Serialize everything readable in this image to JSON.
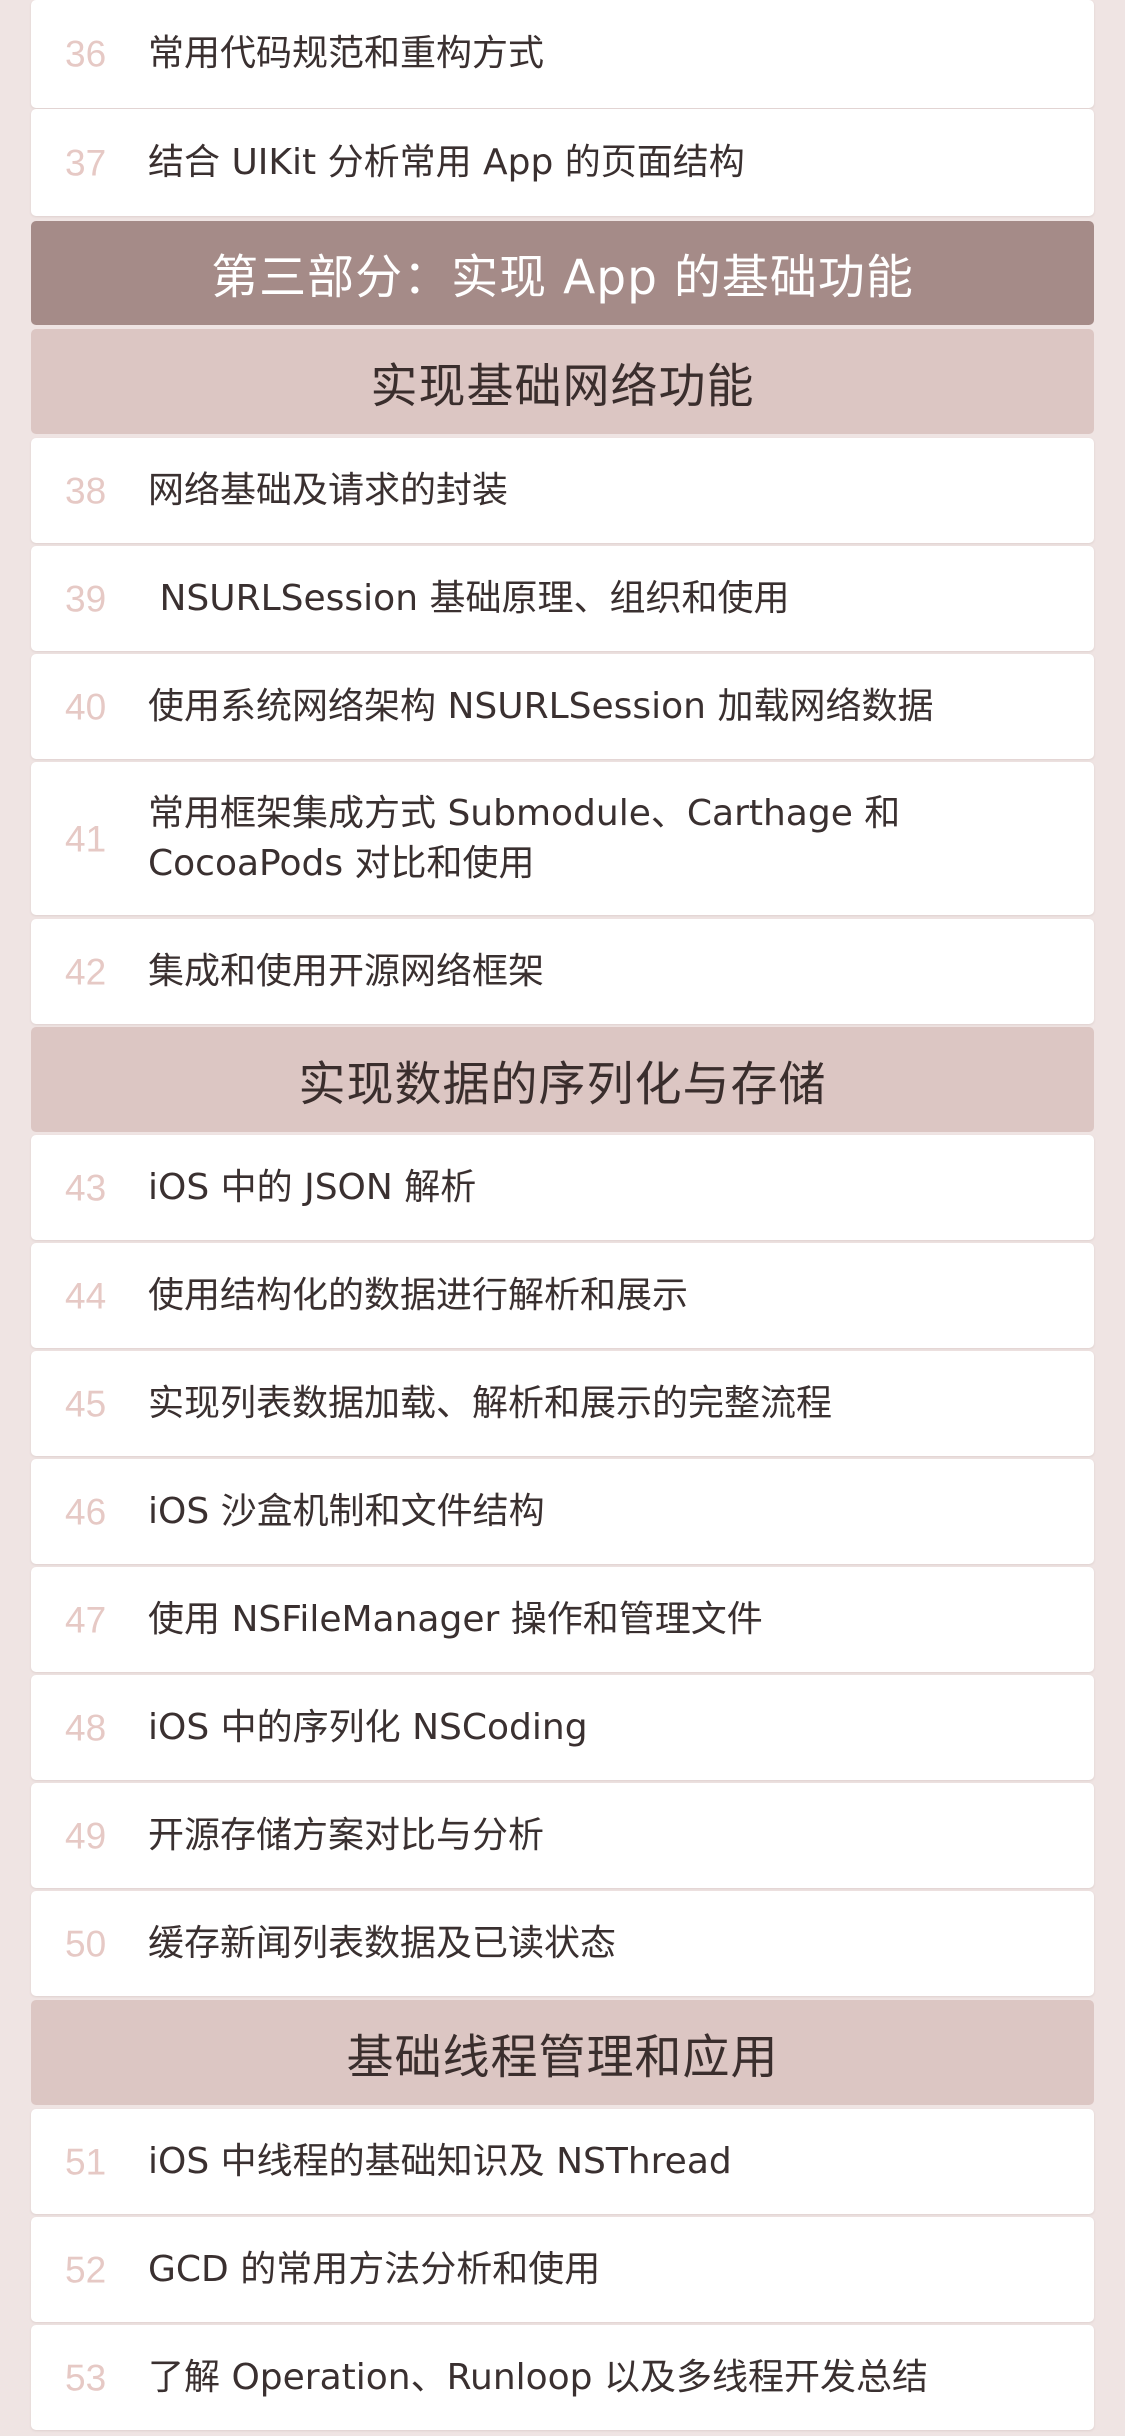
{
  "outline": [
    {
      "kind": "item",
      "num": "36",
      "text": "常用代码规范和重构方式"
    },
    {
      "kind": "item",
      "num": "37",
      "text": "结合 UIKit 分析常用 App 的页面结构"
    },
    {
      "kind": "part",
      "text": "第三部分：实现 App 的基础功能"
    },
    {
      "kind": "section",
      "text": "实现基础网络功能"
    },
    {
      "kind": "item",
      "num": "38",
      "text": "网络基础及请求的封装"
    },
    {
      "kind": "item",
      "num": "39",
      "text": " NSURLSession 基础原理、组织和使用"
    },
    {
      "kind": "item",
      "num": "40",
      "text": "使用系统网络架构 NSURLSession 加载网络数据"
    },
    {
      "kind": "item",
      "num": "41",
      "text": "常用框架集成方式 Submodule、Carthage 和\nCocoaPods 对比和使用"
    },
    {
      "kind": "item",
      "num": "42",
      "text": "集成和使用开源网络框架"
    },
    {
      "kind": "section",
      "text": "实现数据的序列化与存储"
    },
    {
      "kind": "item",
      "num": "43",
      "text": "iOS 中的 JSON 解析"
    },
    {
      "kind": "item",
      "num": "44",
      "text": "使用结构化的数据进行解析和展示"
    },
    {
      "kind": "item",
      "num": "45",
      "text": "实现列表数据加载、解析和展示的完整流程"
    },
    {
      "kind": "item",
      "num": "46",
      "text": "iOS 沙盒机制和文件结构"
    },
    {
      "kind": "item",
      "num": "47",
      "text": "使用 NSFileManager 操作和管理文件"
    },
    {
      "kind": "item",
      "num": "48",
      "text": "iOS 中的序列化 NSCoding"
    },
    {
      "kind": "item",
      "num": "49",
      "text": "开源存储方案对比与分析"
    },
    {
      "kind": "item",
      "num": "50",
      "text": "缓存新闻列表数据及已读状态"
    },
    {
      "kind": "section",
      "text": "基础线程管理和应用"
    },
    {
      "kind": "item",
      "num": "51",
      "text": "iOS 中线程的基础知识及 NSThread"
    },
    {
      "kind": "item",
      "num": "52",
      "text": "GCD 的常用方法分析和使用"
    },
    {
      "kind": "item",
      "num": "53",
      "text": "了解 Operation、Runloop 以及多线程开发总结"
    }
  ]
}
